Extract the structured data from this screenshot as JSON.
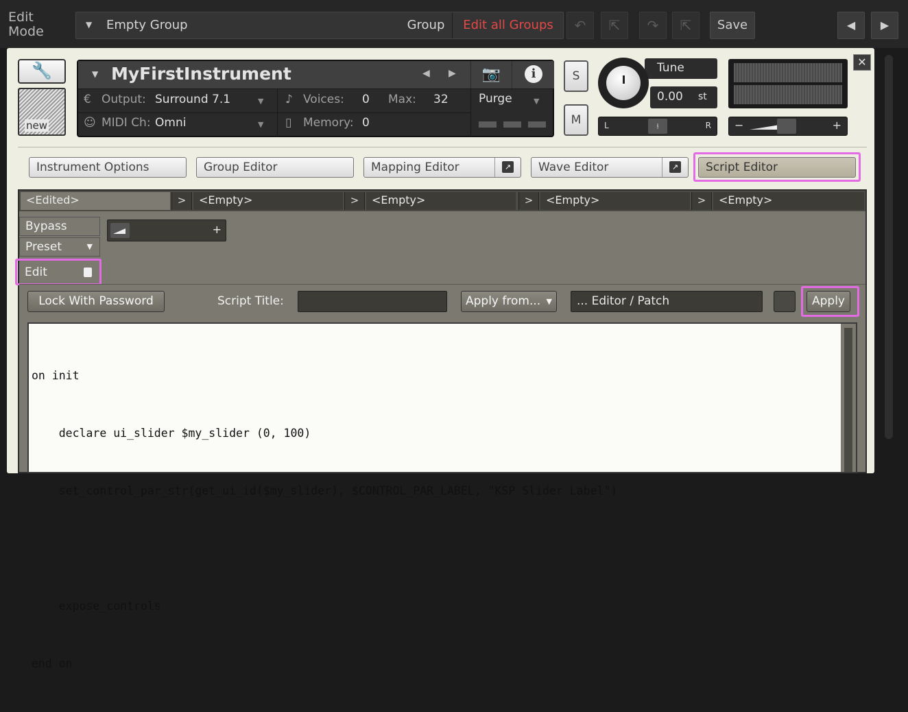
{
  "topbar": {
    "edit_mode": [
      "Edit",
      "Mode"
    ],
    "group_name": "Empty Group",
    "group_label": "Group",
    "edit_all_groups": "Edit all Groups",
    "save_label": "Save"
  },
  "instrument": {
    "name": "MyFirstInstrument",
    "output_label": "Output:",
    "output_value": "Surround 7.1",
    "voices_label": "Voices:",
    "voices_value": "0",
    "max_label": "Max:",
    "max_value": "32",
    "midi_label": "MIDI Ch:",
    "midi_value": "Omni",
    "memory_label": "Memory:",
    "memory_value": "0",
    "purge_label": "Purge",
    "new_label": "new"
  },
  "controls": {
    "solo": "S",
    "mute": "M",
    "tune_label": "Tune",
    "tune_value": "0.00",
    "tune_unit": "st",
    "pan_left": "L",
    "pan_right": "R",
    "vol_minus": "−",
    "vol_plus": "+"
  },
  "editors": {
    "instrument_options": "Instrument Options",
    "group_editor": "Group Editor",
    "mapping_editor": "Mapping Editor",
    "wave_editor": "Wave Editor",
    "script_editor": "Script Editor"
  },
  "script": {
    "slots": [
      "<Edited>",
      "<Empty>",
      "<Empty>",
      "<Empty>",
      "<Empty>"
    ],
    "bypass": "Bypass",
    "preset": "Preset",
    "edit": "Edit",
    "lock_with_password": "Lock With Password",
    "script_title_label": "Script Title:",
    "script_title_value": "",
    "apply_from": "Apply from...",
    "editor_patch": "... Editor / Patch",
    "apply": "Apply",
    "code_lines": [
      "on init",
      "    declare ui_slider $my_slider (0, 100)",
      "    set_control_par_str(get_ui_id($my_slider), $CONTROL_PAR_LABEL, \"KSP Slider Label\")",
      "",
      "    expose_controls",
      "end on"
    ]
  },
  "colors": {
    "highlight": "#e36ce5",
    "edit_all_groups": "#e64848",
    "panel_bg": "#efeee2"
  }
}
